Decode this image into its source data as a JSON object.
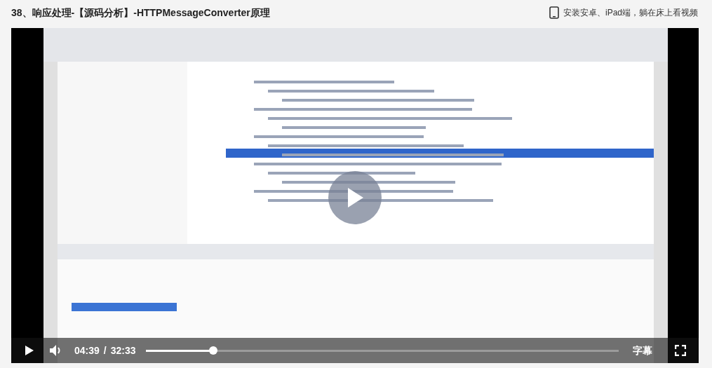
{
  "title": "38、响应处理-【源码分析】-HTTPMessageConverter原理",
  "app_promo": {
    "label": "安装安卓、iPad端，躺在床上看视频"
  },
  "player": {
    "paused": true,
    "current_time": "04:39",
    "separator": "/",
    "duration": "32:33",
    "progress": {
      "level": 0.143
    },
    "subtitle_button": "字幕"
  }
}
